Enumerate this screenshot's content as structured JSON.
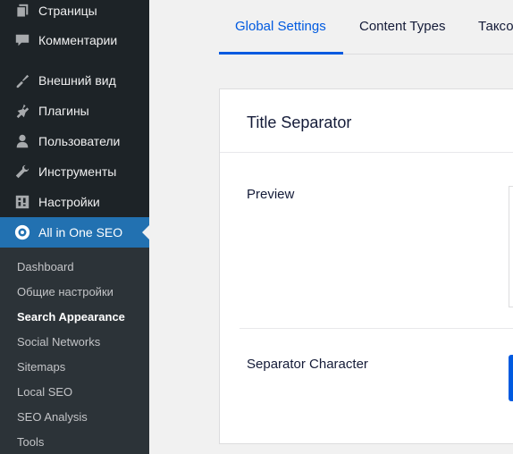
{
  "sidebar": {
    "items": [
      {
        "label": "Страницы",
        "icon": "pages-icon"
      },
      {
        "label": "Комментарии",
        "icon": "comments-icon"
      },
      {
        "label": "Внешний вид",
        "icon": "appearance-icon"
      },
      {
        "label": "Плагины",
        "icon": "plugins-icon"
      },
      {
        "label": "Пользователи",
        "icon": "users-icon"
      },
      {
        "label": "Инструменты",
        "icon": "tools-icon"
      },
      {
        "label": "Настройки",
        "icon": "settings-icon"
      },
      {
        "label": "All in One SEO",
        "icon": "aioseo-icon",
        "active": true
      }
    ],
    "submenu": [
      {
        "label": "Dashboard"
      },
      {
        "label": "Общие настройки"
      },
      {
        "label": "Search Appearance",
        "current": true
      },
      {
        "label": "Social Networks"
      },
      {
        "label": "Sitemaps"
      },
      {
        "label": "Local SEO"
      },
      {
        "label": "SEO Analysis"
      },
      {
        "label": "Tools"
      }
    ]
  },
  "tabs": [
    {
      "label": "Global Settings",
      "active": true
    },
    {
      "label": "Content Types"
    },
    {
      "label": "Таксо"
    }
  ],
  "card": {
    "title": "Title Separator",
    "preview_label": "Preview",
    "separator_label": "Separator Character"
  },
  "colors": {
    "sidebar_bg": "#1d2327",
    "submenu_bg": "#2c3338",
    "active_menu": "#2271b1",
    "accent": "#005ae0"
  }
}
